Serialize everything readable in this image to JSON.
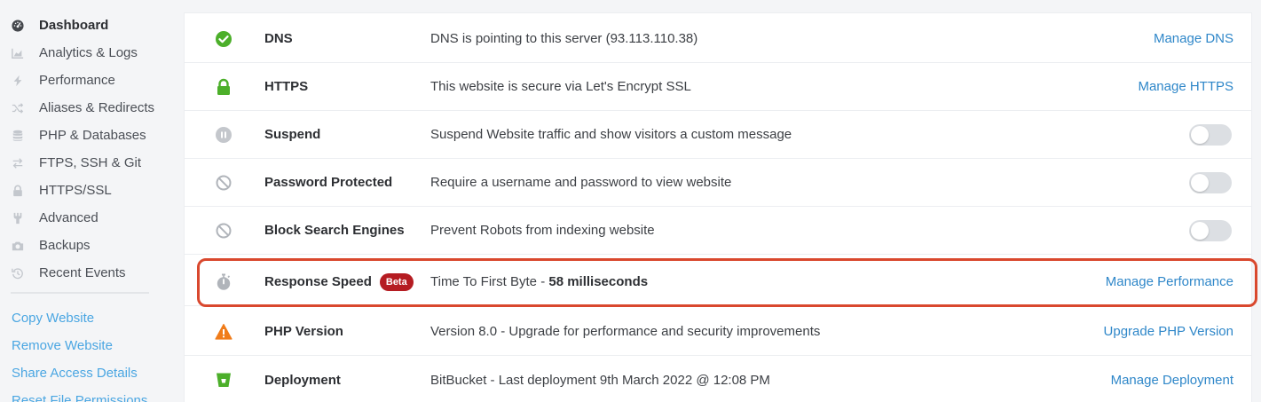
{
  "sidebar": {
    "items": [
      {
        "label": "Dashboard",
        "icon": "dashboard-icon",
        "active": true
      },
      {
        "label": "Analytics & Logs",
        "icon": "chart-icon"
      },
      {
        "label": "Performance",
        "icon": "bolt-icon"
      },
      {
        "label": "Aliases & Redirects",
        "icon": "shuffle-icon"
      },
      {
        "label": "PHP & Databases",
        "icon": "database-icon"
      },
      {
        "label": "FTPS, SSH & Git",
        "icon": "exchange-icon"
      },
      {
        "label": "HTTPS/SSL",
        "icon": "lock-icon"
      },
      {
        "label": "Advanced",
        "icon": "wrench-icon"
      },
      {
        "label": "Backups",
        "icon": "camera-icon"
      },
      {
        "label": "Recent Events",
        "icon": "history-icon"
      }
    ],
    "links": [
      {
        "label": "Copy Website"
      },
      {
        "label": "Remove Website"
      },
      {
        "label": "Share Access Details"
      },
      {
        "label": "Reset File Permissions"
      }
    ]
  },
  "rows": [
    {
      "label": "DNS",
      "desc": "DNS is pointing to this server (93.113.110.38)",
      "action": "Manage DNS",
      "icon": "check-circle-icon"
    },
    {
      "label": "HTTPS",
      "desc": "This website is secure via Let's Encrypt SSL",
      "action": "Manage HTTPS",
      "icon": "lock-icon"
    },
    {
      "label": "Suspend",
      "desc": "Suspend Website traffic and show visitors a custom message",
      "icon": "pause-circle-icon",
      "toggle": false
    },
    {
      "label": "Password Protected",
      "desc": "Require a username and password to view website",
      "icon": "ban-icon",
      "toggle": false
    },
    {
      "label": "Block Search Engines",
      "desc": "Prevent Robots from indexing website",
      "icon": "ban-icon",
      "toggle": false
    },
    {
      "label": "Response Speed",
      "badge": "Beta",
      "desc_prefix": "Time To First Byte - ",
      "desc_strong": "58 milliseconds",
      "action": "Manage Performance",
      "icon": "stopwatch-icon"
    },
    {
      "label": "PHP Version",
      "desc": "Version 8.0 - Upgrade for performance and security improvements",
      "action": "Upgrade PHP Version",
      "icon": "warning-icon"
    },
    {
      "label": "Deployment",
      "desc": "BitBucket - Last deployment 9th March 2022 @ 12:08 PM",
      "action": "Manage Deployment",
      "icon": "bitbucket-icon"
    }
  ],
  "colors": {
    "accent": "#2f87c9",
    "sidebar_link": "#4aa6e2",
    "success": "#4caf2a",
    "warning": "#f07c1a",
    "badge": "#b51c22",
    "highlight": "#d9482e"
  }
}
